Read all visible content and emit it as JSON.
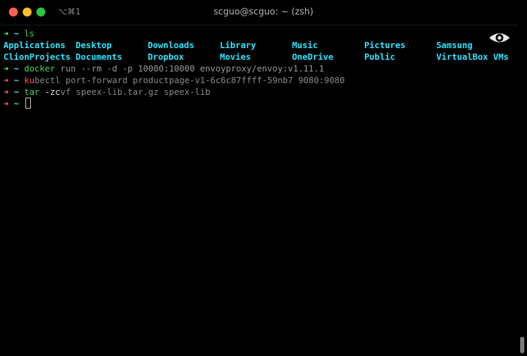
{
  "window": {
    "title": "scguo@scguo: ~ (zsh)",
    "shortcut": "⌥⌘1",
    "colors": {
      "close": "#fe5f57",
      "minimize": "#febc2e",
      "zoom": "#28c840",
      "arrow_ok": "#5ef26e",
      "arrow_err": "#ff6a6a",
      "prompt": "#4de0e0",
      "command_valid": "#47d45f",
      "command_invalid": "#f25a5a",
      "ls_dir": "#2ae6ff",
      "text": "#9a9a9a"
    }
  },
  "terminal": {
    "line1": {
      "arrow": "➜",
      "tilde": "~",
      "cmd": "ls"
    },
    "ls_entries": [
      "Applications",
      "Desktop",
      "Downloads",
      "Library",
      "Music",
      "Pictures",
      "Samsung",
      "ClionProjects",
      "Documents",
      "Dropbox",
      "Movies",
      "OneDrive",
      "Public",
      "VirtualBox VMs"
    ],
    "line3": {
      "arrow": "➜",
      "tilde": "~",
      "cmd": "docker",
      "args": " run --rm -d -p 10000:10000 envoyproxy/envoy:v1.11.1"
    },
    "line4": {
      "arrow": "➜",
      "tilde": "~",
      "cmd_typed": "ku",
      "args": "bectl port-forward productpage-v1-6c6c87ffff-59nb7 9080:9080"
    },
    "line5": {
      "arrow": "➜",
      "tilde": "~",
      "cmd": "tar",
      "flag": "-zc",
      "args": "vf speex-lib.tar.gz speex-lib"
    },
    "line6": {
      "arrow": "➜",
      "tilde": "~"
    }
  },
  "icons": {
    "eye": "eye-icon"
  }
}
